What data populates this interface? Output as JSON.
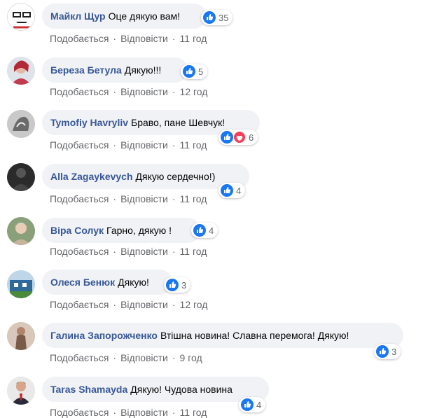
{
  "actions": {
    "like": "Подобається",
    "reply": "Відповісти",
    "sep": "·"
  },
  "colors": {
    "like": "#1877f2",
    "love": "#f33e58",
    "author": "#385898",
    "bubble": "#f0f2f5"
  },
  "comments": [
    {
      "author": "Майкл Щур",
      "text": "Оце дякую вам!",
      "reactions": [
        "like"
      ],
      "count": "35",
      "time": "11 год"
    },
    {
      "author": "Береза Бетула",
      "text": "Дякую!!!",
      "reactions": [
        "like"
      ],
      "count": "5",
      "time": "12 год"
    },
    {
      "author": "Tymofiy Havryliv",
      "text": "Браво, пане Шевчук!",
      "reactions": [
        "like",
        "love"
      ],
      "count": "6",
      "time": "11 год"
    },
    {
      "author": "Alla Zagaykevych",
      "text": "Дякую сердечно!)",
      "reactions": [
        "like"
      ],
      "count": "4",
      "time": "11 год"
    },
    {
      "author": "Віра Солук",
      "text": "Гарно, дякую !",
      "reactions": [
        "like"
      ],
      "count": "4",
      "time": "11 год"
    },
    {
      "author": "Олеся Бенюк",
      "text": "Дякую!",
      "reactions": [
        "like"
      ],
      "count": "3",
      "time": "12 год"
    },
    {
      "author": "Галина Запорожченко",
      "text": "Втішна новина! Славна перемога! Дякую!",
      "reactions": [
        "like"
      ],
      "count": "3",
      "time": "9 год"
    },
    {
      "author": "Taras Shamayda",
      "text": "Дякую! Чудова новина",
      "reactions": [
        "like"
      ],
      "count": "4",
      "time": "11 год"
    }
  ]
}
